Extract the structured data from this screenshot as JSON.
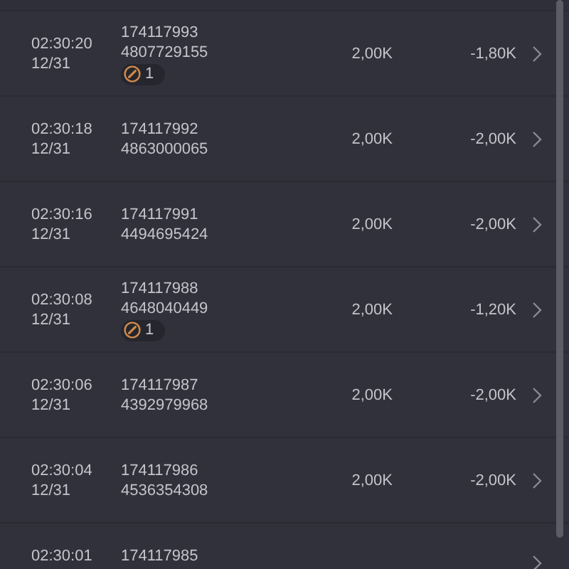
{
  "rows": [
    {
      "time": "02:30:20",
      "date": "12/31",
      "id": "174117993",
      "number": "4807729155",
      "badge": "1",
      "amount": "2,00K",
      "change": "-1,80K"
    },
    {
      "time": "02:30:18",
      "date": "12/31",
      "id": "174117992",
      "number": "4863000065",
      "amount": "2,00K",
      "change": "-2,00K"
    },
    {
      "time": "02:30:16",
      "date": "12/31",
      "id": "174117991",
      "number": "4494695424",
      "amount": "2,00K",
      "change": "-2,00K"
    },
    {
      "time": "02:30:08",
      "date": "12/31",
      "id": "174117988",
      "number": "4648040449",
      "badge": "1",
      "amount": "2,00K",
      "change": "-1,20K"
    },
    {
      "time": "02:30:06",
      "date": "12/31",
      "id": "174117987",
      "number": "4392979968",
      "amount": "2,00K",
      "change": "-2,00K"
    },
    {
      "time": "02:30:04",
      "date": "12/31",
      "id": "174117986",
      "number": "4536354308",
      "amount": "2,00K",
      "change": "-2,00K"
    },
    {
      "time": "02:30:01",
      "id": "174117985"
    }
  ]
}
